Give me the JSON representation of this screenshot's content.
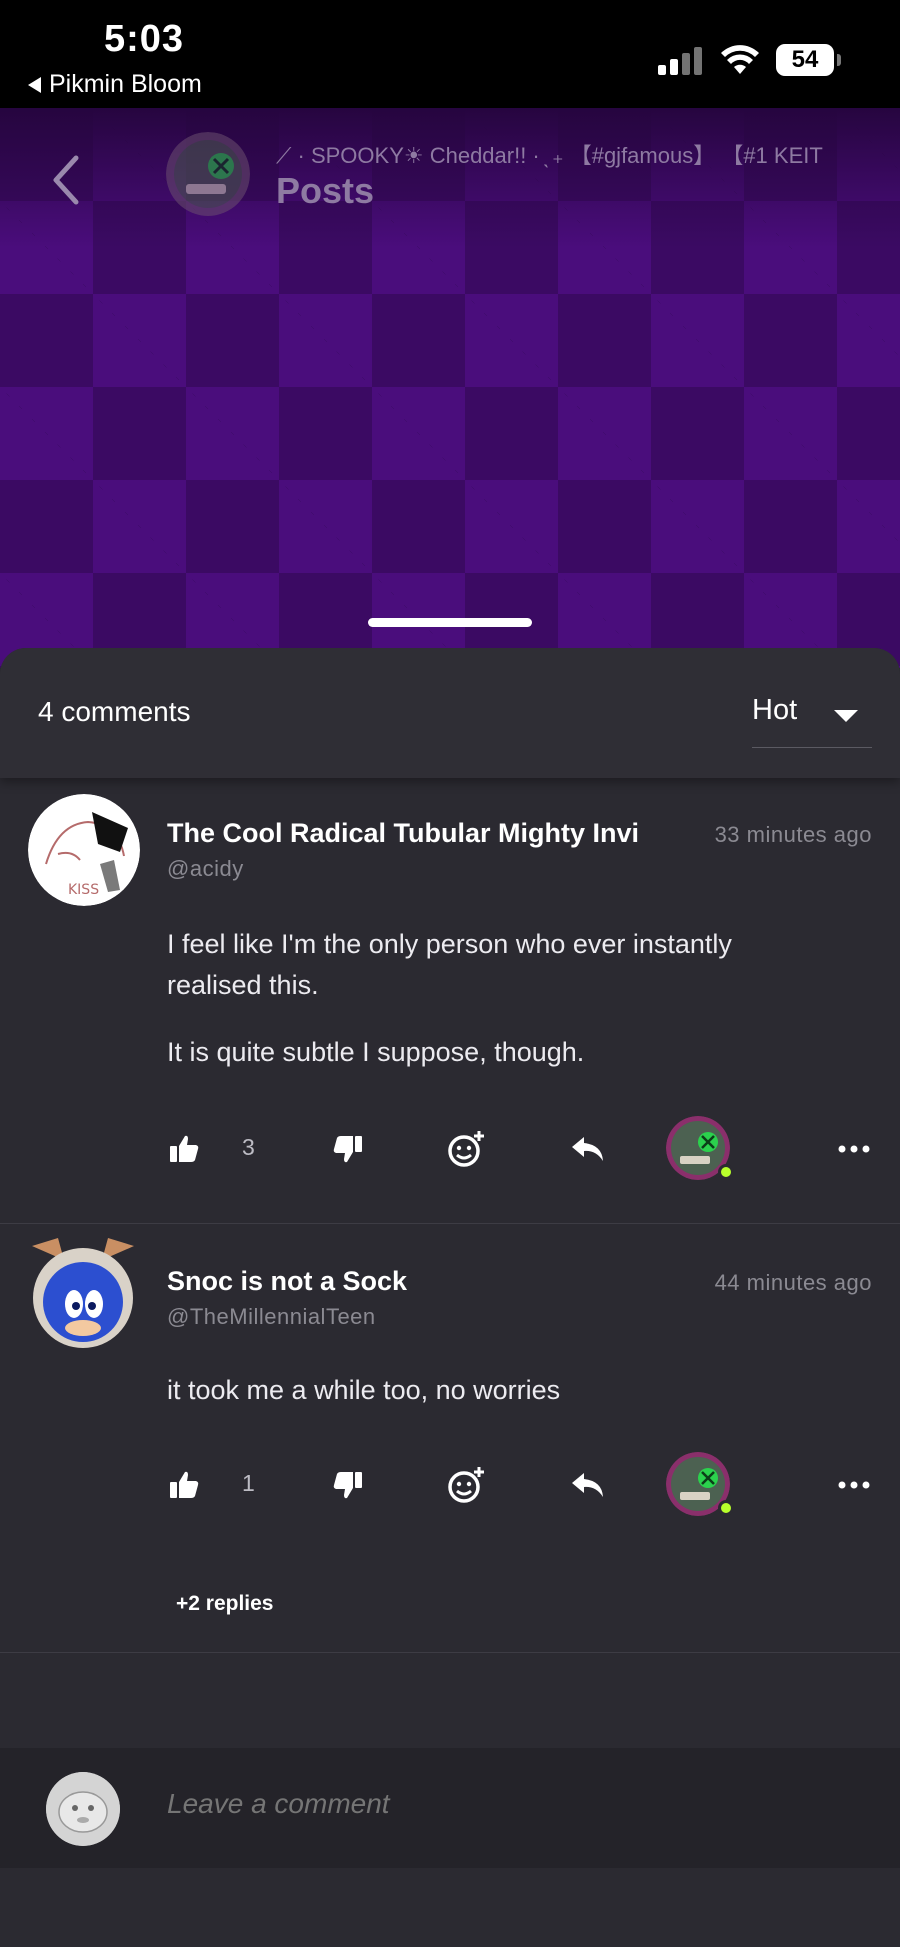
{
  "status_bar": {
    "time": "5:03",
    "back_app": "Pikmin Bloom",
    "battery": "54"
  },
  "header": {
    "title": "Posts",
    "group_name": "⟋ · SPOOKY☀ Cheddar!! · ̖ ₊ 【#gjfamous】 【#1 KEIT"
  },
  "sheet": {
    "comment_count": "4 comments",
    "sort": {
      "selected": "Hot"
    }
  },
  "comments": [
    {
      "name": "The Cool Radical Tubular Mighty Invi",
      "handle": "@acidy",
      "time": "33 minutes ago",
      "body": [
        "I feel like I'm the only person who ever instantly realised this.",
        "It is quite subtle I suppose, though."
      ],
      "likes": "3"
    },
    {
      "name": "Snoc is not a Sock",
      "handle": "@TheMillennialTeen",
      "time": "44 minutes ago",
      "body": [
        "it took me a while too, no worries"
      ],
      "likes": "1",
      "more_replies": "+2 replies"
    }
  ],
  "compose": {
    "placeholder": "Leave a comment"
  },
  "icons": {
    "back": "chevron-left-icon",
    "like": "thumbs-up-icon",
    "dislike": "thumbs-down-icon",
    "react": "add-reaction-icon",
    "reply": "reply-icon",
    "more": "more-icon"
  },
  "colors": {
    "banner_purple": "#3b0a63",
    "sheet_bg": "#2b2a31",
    "online_dot": "#b8ff2b"
  }
}
